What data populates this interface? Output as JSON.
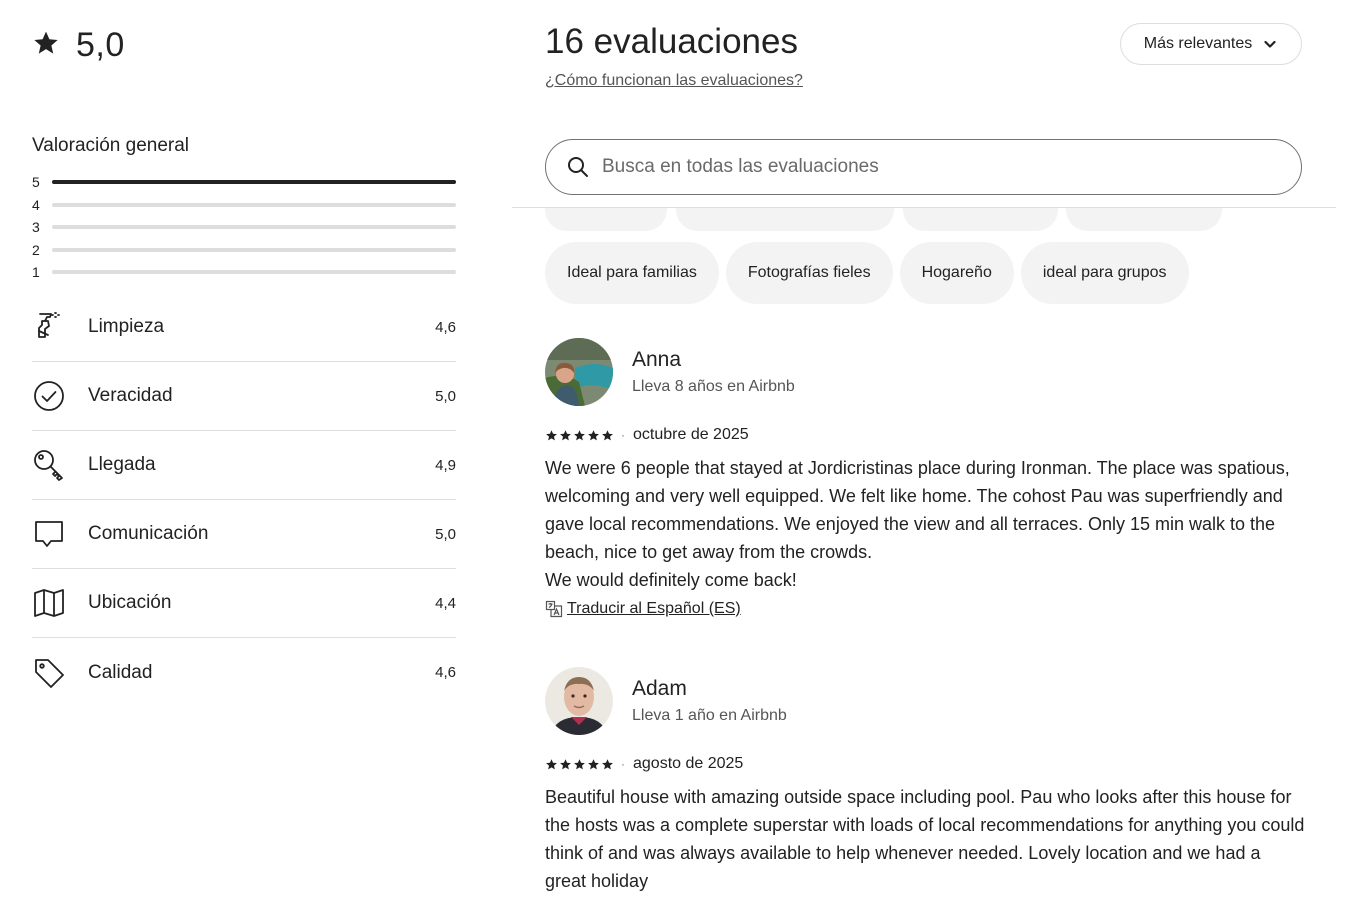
{
  "overall": {
    "score": "5,0",
    "icon": "star-icon"
  },
  "general": {
    "title": "Valoración general",
    "distribution": [
      {
        "label": "5",
        "fraction": 1.0
      },
      {
        "label": "4",
        "fraction": 0.0
      },
      {
        "label": "3",
        "fraction": 0.0
      },
      {
        "label": "2",
        "fraction": 0.0
      },
      {
        "label": "1",
        "fraction": 0.0
      }
    ]
  },
  "categories": [
    {
      "label": "Limpieza",
      "value": "4,6",
      "icon": "spray-bottle-icon"
    },
    {
      "label": "Veracidad",
      "value": "5,0",
      "icon": "check-circle-icon"
    },
    {
      "label": "Llegada",
      "value": "4,9",
      "icon": "key-icon"
    },
    {
      "label": "Comunicación",
      "value": "5,0",
      "icon": "chat-bubble-icon"
    },
    {
      "label": "Ubicación",
      "value": "4,4",
      "icon": "map-icon"
    },
    {
      "label": "Calidad",
      "value": "4,6",
      "icon": "price-tag-icon"
    }
  ],
  "header": {
    "title": "16 evaluaciones",
    "how_link": "¿Cómo funcionan las evaluaciones?",
    "sort_label": "Más relevantes"
  },
  "search": {
    "placeholder": "Busca en todas las evaluaciones"
  },
  "chips": [
    "Ideal para familias",
    "Fotografías fieles",
    "Hogareño",
    "ideal para grupos"
  ],
  "reviews": [
    {
      "name": "Anna",
      "tenure": "Lleva 8 años en Airbnb",
      "rating": 5,
      "date": "octubre de 2025",
      "text": "We were 6 people that stayed at Jordicristinas place during Ironman. The place was spatious, welcoming and very well equipped. We felt like home. The cohost Pau was superfriendly and gave local recommendations. We enjoyed the view and all terraces. Only 15 min walk to the beach, nice to get away from the crowds.\nWe would definitely come back!",
      "translate_label": "Traducir al Español (ES)"
    },
    {
      "name": "Adam",
      "tenure": "Lleva 1 año en Airbnb",
      "rating": 5,
      "date": "agosto de 2025",
      "text": "Beautiful house with amazing outside space including pool. Pau who looks after this house for the hosts was a complete superstar with loads of local recommendations for anything you could think of and was always available to help whenever needed. Lovely location and we had a great holiday"
    }
  ]
}
